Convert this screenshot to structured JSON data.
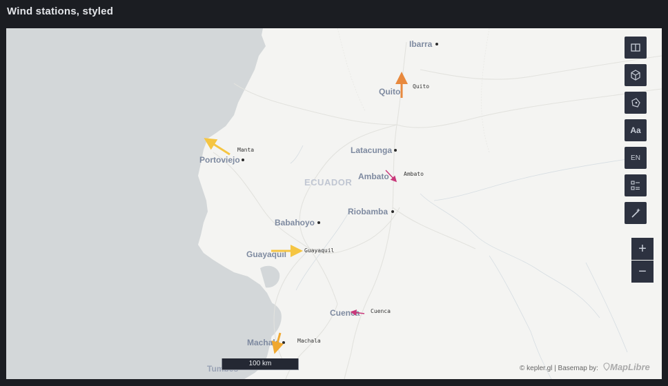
{
  "header": {
    "title": "Wind stations, styled"
  },
  "map": {
    "country_label": "ECUADOR",
    "cities": [
      {
        "name": "Ibarra"
      },
      {
        "name": "Quito"
      },
      {
        "name": "Latacunga"
      },
      {
        "name": "Ambato"
      },
      {
        "name": "Riobamba"
      },
      {
        "name": "Babahoyo"
      },
      {
        "name": "Guayaquil"
      },
      {
        "name": "Cuenca"
      },
      {
        "name": "Machala"
      },
      {
        "name": "Portoviejo"
      },
      {
        "name": "Tumbes"
      }
    ],
    "stations": [
      {
        "name": "Quito",
        "color": "#e8893e"
      },
      {
        "name": "Manta",
        "color": "#f5c542"
      },
      {
        "name": "Ambato",
        "color": "#c9387a"
      },
      {
        "name": "Guayaquil",
        "color": "#f5c542"
      },
      {
        "name": "Cuenca",
        "color": "#c9387a"
      },
      {
        "name": "Machala",
        "color": "#f0a830"
      }
    ],
    "colors": {
      "water": "#d3d7d9",
      "land": "#f4f4f2",
      "roads": "#e0e0dc"
    }
  },
  "controls": {
    "split_map": "split-map-icon",
    "perspective_3d": "cube-icon",
    "draw": "draw-polygon-icon",
    "labels": "Aa",
    "language": "EN",
    "legend": "legend-icon",
    "effects": "magic-wand-icon",
    "zoom_in": "+",
    "zoom_out": "−"
  },
  "scale": {
    "label": "100 km"
  },
  "attribution": {
    "text": "© kepler.gl | Basemap by:",
    "brand": "MapLibre"
  }
}
